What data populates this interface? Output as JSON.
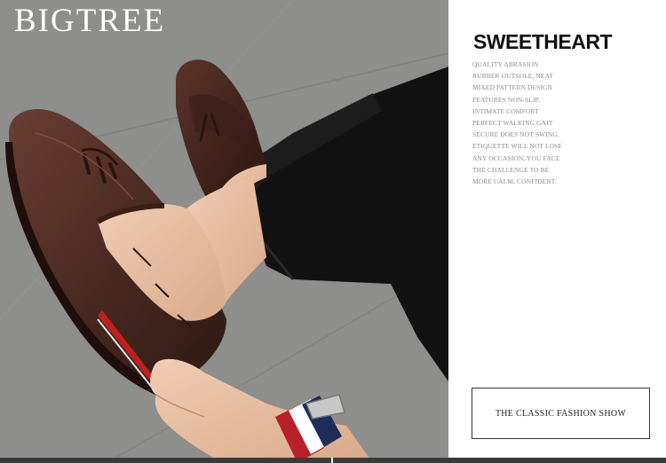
{
  "brand": "BIGTREE",
  "headline": "SWEETHEART",
  "description_lines": [
    "QUALITY ABRASION",
    "RUBBER OUTSOLE, NEAT",
    "MIXED PATTERN DESIGN",
    "FEATURES NON-SLIP,",
    "INTIMATE COMFORT",
    "PERFECT WALKING GAIT",
    "SECURE DOES NOT SWING,",
    "ETIQUETTE WILL NOT LOSE",
    "ANY OCCASION, YOU FACE",
    "THE CHALLENGE TO BE",
    "MORE CALM, CONFIDENT."
  ],
  "tagline": "THE CLASSIC FASHION SHOW",
  "colors": {
    "shoe_leather": "#4a2a22",
    "trousers": "#111111",
    "floor": "#8c8c8a",
    "sole_stripe": "#c02020"
  },
  "photo_subject": "brown-tassel-loafers-product-photo"
}
